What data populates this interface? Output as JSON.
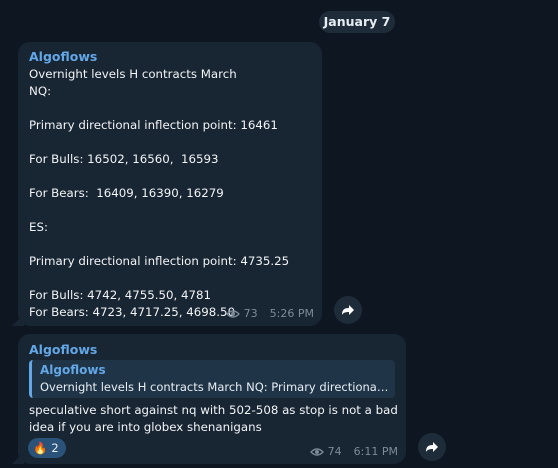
{
  "date_separator": "January 7",
  "messages": [
    {
      "sender": "Algoflows",
      "text": "Overnight levels H contracts March\nNQ:\n\nPrimary directional inflection point: 16461\n\nFor Bulls: 16502, 16560,  16593\n\nFor Bears:  16409, 16390, 16279\n\nES:\n\nPrimary directional inflection point: 4735.25\n\nFor Bulls: 4742, 4755.50, 4781\nFor Bears: 4723, 4717.25, 4698.50",
      "views": "73",
      "time": "5:26 PM"
    },
    {
      "sender": "Algoflows",
      "reply": {
        "sender": "Algoflows",
        "text": "Overnight levels H contracts March NQ:  Primary directional i..."
      },
      "text": "speculative short against nq with 502-508 as stop is not a bad\nidea if you are into globex shenanigans",
      "reaction": {
        "icon": "fire-icon",
        "emoji": "🔥",
        "count": "2"
      },
      "views": "74",
      "time": "6:11 PM"
    }
  ],
  "icons": {
    "views": "eye-icon",
    "share": "share-arrow-icon"
  },
  "colors": {
    "background": "#0e1621",
    "bubble": "#182533",
    "accent": "#63a7e6",
    "reaction": "#2b5278"
  }
}
